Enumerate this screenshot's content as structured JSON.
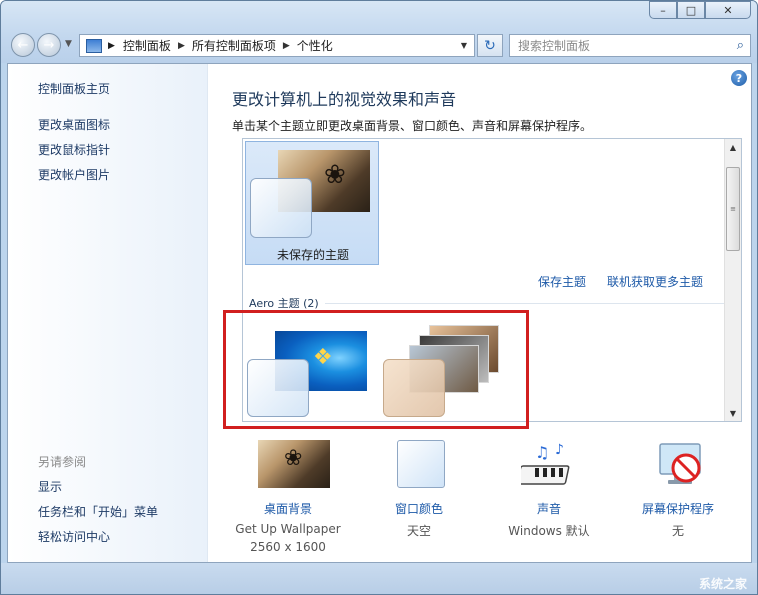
{
  "navbar": {
    "breadcrumbs": [
      "控制面板",
      "所有控制面板项",
      "个性化"
    ],
    "search_placeholder": "搜索控制面板"
  },
  "sidebar": {
    "home": "控制面板主页",
    "links": [
      "更改桌面图标",
      "更改鼠标指针",
      "更改帐户图片"
    ],
    "see_also": "另请参阅",
    "see_also_links": [
      "显示",
      "任务栏和「开始」菜单",
      "轻松访问中心"
    ]
  },
  "main": {
    "title": "更改计算机上的视觉效果和声音",
    "subtitle": "单击某个主题立即更改桌面背景、窗口颜色、声音和屏幕保护程序。",
    "unsaved_theme": "未保存的主题",
    "save_theme": "保存主题",
    "get_more": "联机获取更多主题",
    "aero_header": "Aero 主题 (2)"
  },
  "bottom": {
    "wallpaper": {
      "label": "桌面背景",
      "line1": "Get Up Wallpaper",
      "line2": "2560 x 1600"
    },
    "color": {
      "label": "窗口颜色",
      "line1": "天空"
    },
    "sound": {
      "label": "声音",
      "line1": "Windows 默认"
    },
    "saver": {
      "label": "屏幕保护程序",
      "line1": "无"
    }
  },
  "watermark": "系统之家",
  "colors": {
    "accent": "#1e5aa8",
    "highlight": "#d11f1f"
  }
}
